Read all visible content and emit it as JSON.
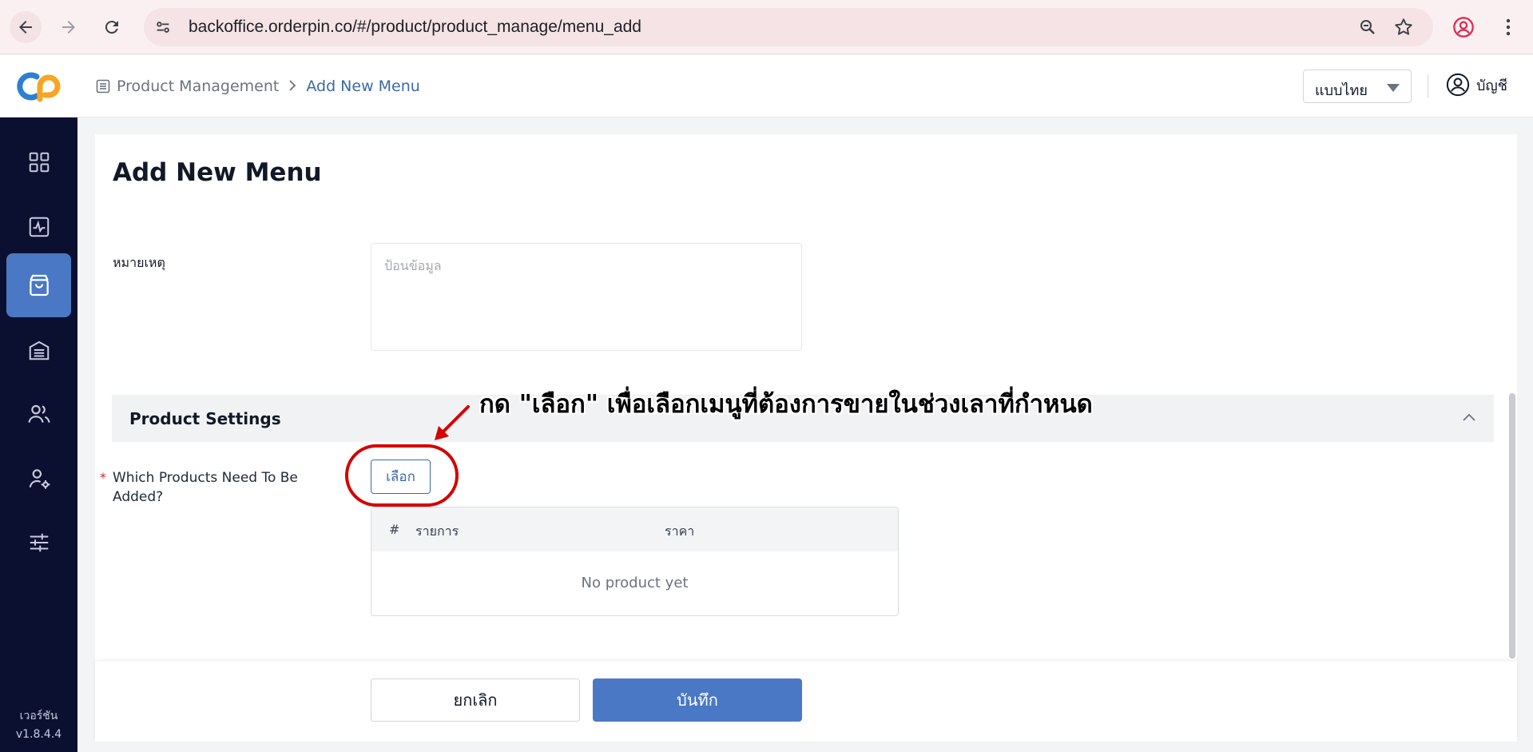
{
  "browser": {
    "url": "backoffice.orderpin.co/#/product/product_manage/menu_add"
  },
  "header": {
    "breadcrumb": [
      "Product Management",
      "Add New Menu"
    ],
    "language": "แบบไทย",
    "account_label": "บัญชี"
  },
  "sidebar": {
    "items": [
      {
        "icon": "dashboard-grid-icon",
        "active": false
      },
      {
        "icon": "activity-chart-icon",
        "active": false
      },
      {
        "icon": "shopping-bag-icon",
        "active": true
      },
      {
        "icon": "warehouse-icon",
        "active": false
      },
      {
        "icon": "users-icon",
        "active": false
      },
      {
        "icon": "user-settings-icon",
        "active": false
      },
      {
        "icon": "sliders-icon",
        "active": false
      }
    ],
    "version_label": "เวอร์ชัน",
    "version_number": "v1.8.4.4"
  },
  "page": {
    "title": "Add New Menu",
    "note_label": "หมายเหตุ",
    "note_placeholder": "ป้อนข้อมูล",
    "section_title": "Product Settings",
    "products_label": "Which Products Need To Be Added?",
    "select_button": "เลือก",
    "annotation": "กด \"เลือก\" เพื่อเลือกเมนูที่ต้องการขายในช่วงเลาที่กำหนด",
    "table": {
      "columns": [
        "#",
        "รายการ",
        "ราคา"
      ],
      "empty_message": "No product yet"
    }
  },
  "footer": {
    "cancel": "ยกเลิก",
    "save": "บันทึก"
  },
  "colors": {
    "accent": "#4a78c4",
    "sidebar_bg": "#0c1030",
    "link": "#3a6aa5",
    "highlight": "#d40000"
  }
}
